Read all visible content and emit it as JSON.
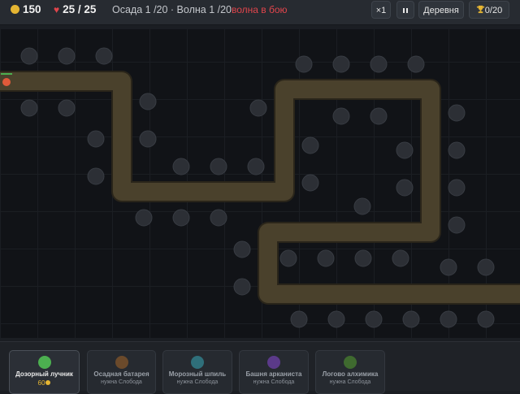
{
  "hud": {
    "gold": "150",
    "lives": "25 / 25",
    "siege_text": "Осада 1 /20 · Волна 1 /20",
    "wave_status": "волна в бою",
    "speed_label": "×1",
    "pause_icon": "pause-icon",
    "village_label": "Деревня",
    "trophy_icon": "trophy-icon",
    "trophies": "0/20"
  },
  "towers": [
    {
      "name": "Дозорный лучник",
      "cost": "60",
      "color": "#4caf50",
      "locked": false
    },
    {
      "name": "Осадная батарея",
      "sub": "нужна Слобода",
      "color": "#6b4a2b",
      "locked": true
    },
    {
      "name": "Морозный шпиль",
      "sub": "нужна Слобода",
      "color": "#2f6f7a",
      "locked": true
    },
    {
      "name": "Башня арканиста",
      "sub": "нужна Слобода",
      "color": "#5b3a8a",
      "locked": true
    },
    {
      "name": "Логово алхимика",
      "sub": "нужна Слобода",
      "color": "#3f6a2f",
      "locked": true
    }
  ],
  "colors": {
    "path": "#4a412c",
    "path_edge": "#2a251a",
    "slot": "#2c2f35",
    "enemy": "#e05a3a",
    "accent_gold": "#e5b532",
    "danger": "#e0454c"
  },
  "enemy": {
    "health_fraction": 1.0
  }
}
